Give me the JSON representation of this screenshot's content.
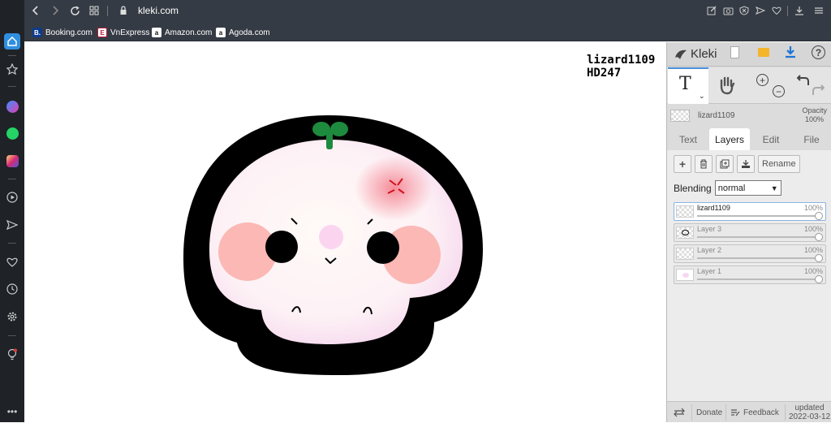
{
  "browser": {
    "url": "kleki.com",
    "bookmarks": [
      {
        "label": "Booking.com",
        "fav": "B.",
        "color": "#0c3b8c"
      },
      {
        "label": "VnExpress",
        "fav": "E",
        "color": "#b81d3a"
      },
      {
        "label": "Amazon.com",
        "fav": "a",
        "color": "#ffffff"
      },
      {
        "label": "Agoda.com",
        "fav": "a",
        "color": "#ffffff"
      }
    ]
  },
  "canvas": {
    "signature_line1": "lizard1109",
    "signature_line2": "HD247"
  },
  "app": {
    "name": "Kleki",
    "layer_name": "lizard1109",
    "opacity_label": "Opacity",
    "opacity_value": "100%",
    "tabs": [
      "Text",
      "Layers",
      "Edit",
      "File"
    ],
    "active_tab": "Layers",
    "rename_label": "Rename",
    "blending_label": "Blending",
    "blending_value": "normal",
    "layers": [
      {
        "name": "lizard1109",
        "opacity": "100%",
        "selected": true
      },
      {
        "name": "Layer 3",
        "opacity": "100%",
        "selected": false
      },
      {
        "name": "Layer 2",
        "opacity": "100%",
        "selected": false
      },
      {
        "name": "Layer 1",
        "opacity": "100%",
        "selected": false
      }
    ],
    "footer": {
      "donate": "Donate",
      "feedback": "Feedback",
      "updated_label": "updated",
      "updated_date": "2022-03-12"
    }
  },
  "colors": {
    "accent": "#4a8fdc",
    "chrome": "#353b44",
    "sidebar": "#1f2328"
  }
}
